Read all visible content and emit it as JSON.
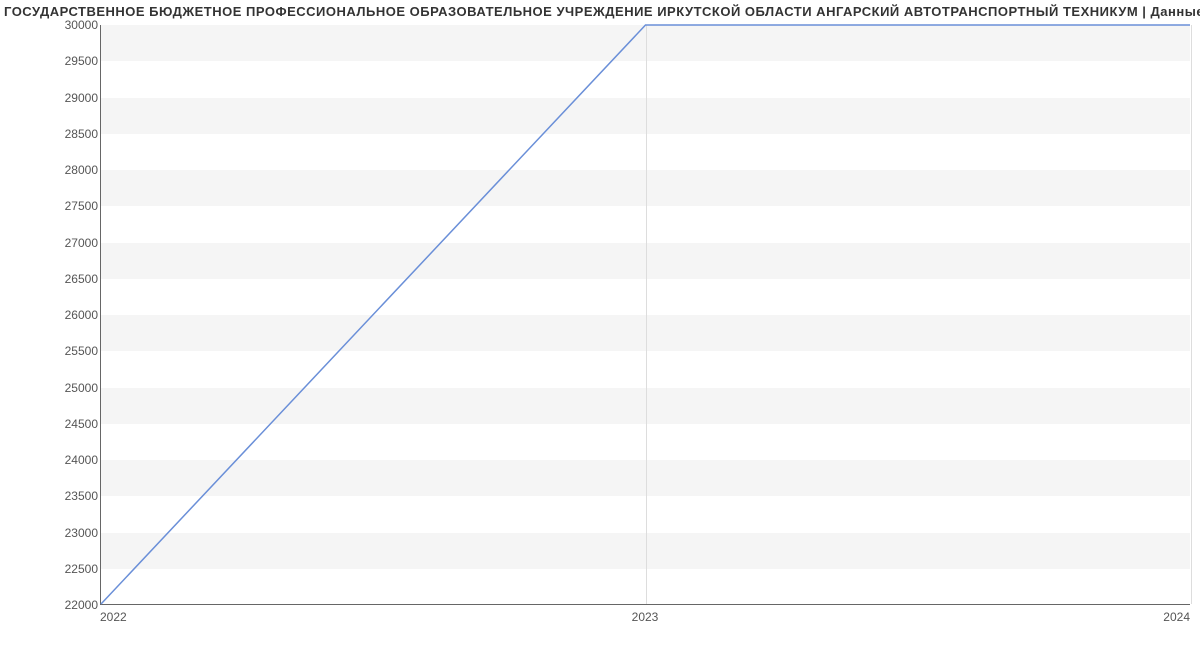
{
  "title": "ГОСУДАРСТВЕННОЕ БЮДЖЕТНОЕ ПРОФЕССИОНАЛЬНОЕ ОБРАЗОВАТЕЛЬНОЕ УЧРЕЖДЕНИЕ ИРКУТСКОЙ ОБЛАСТИ АНГАРСКИЙ АВТОТРАНСПОРТНЫЙ ТЕХНИКУМ | Данные",
  "chart_data": {
    "type": "line",
    "x": [
      "2022",
      "2023",
      "2024"
    ],
    "values": [
      22000,
      30000,
      30000
    ],
    "title": "ГОСУДАРСТВЕННОЕ БЮДЖЕТНОЕ ПРОФЕССИОНАЛЬНОЕ ОБРАЗОВАТЕЛЬНОЕ УЧРЕЖДЕНИЕ ИРКУТСКОЙ ОБЛАСТИ АНГАРСКИЙ АВТОТРАНСПОРТНЫЙ ТЕХНИКУМ | Данные",
    "xlabel": "",
    "ylabel": "",
    "ylim": [
      22000,
      30000
    ],
    "y_ticks": [
      22000,
      22500,
      23000,
      23500,
      24000,
      24500,
      25000,
      25500,
      26000,
      26500,
      27000,
      27500,
      28000,
      28500,
      29000,
      29500,
      30000
    ],
    "x_ticks": [
      "2022",
      "2023",
      "2024"
    ],
    "line_color": "#6a8fd8"
  }
}
